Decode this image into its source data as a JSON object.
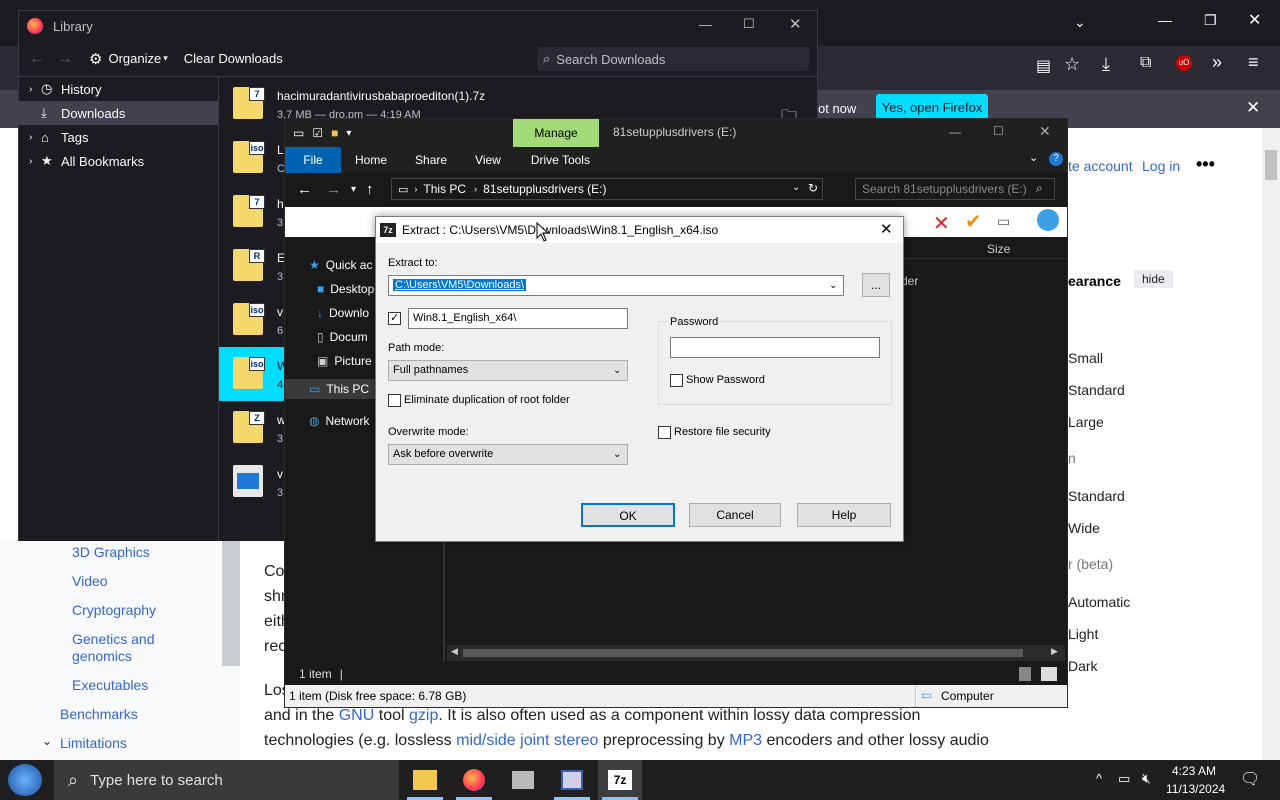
{
  "firefox": {
    "notification": {
      "not_now": "ot now",
      "open_button": "Yes, open Firefox"
    },
    "wiki": {
      "header_links": {
        "create_account": "te account",
        "login": "Log in"
      },
      "appearance": {
        "title": "earance",
        "hide": "hide"
      },
      "options": [
        "Small",
        "Standard",
        "Large",
        "n",
        "Standard",
        "Wide",
        "r (beta)",
        "Automatic",
        "Light",
        "Dark"
      ],
      "sidebar": [
        "3D Graphics",
        "Video",
        "Cryptography",
        "Genetics and",
        "genomics",
        "Executables",
        "Benchmarks",
        "Limitations"
      ],
      "body_lines": [
        "Co",
        "shr",
        "eith",
        "rec",
        "Los"
      ],
      "line1_a": "and in the ",
      "line1_gnu": "GNU",
      "line1_b": " tool ",
      "line1_gzip": "gzip",
      "line1_c": ". It is also often used as a component within lossy data compression",
      "line2_a": "technologies (e.g. lossless ",
      "line2_ms": "mid/side joint stereo",
      "line2_b": " preprocessing by ",
      "line2_mp3": "MP3",
      "line2_c": " encoders and other lossy audio"
    }
  },
  "library": {
    "title": "Library",
    "organize": "Organize",
    "clear": "Clear Downloads",
    "search_placeholder": "Search Downloads",
    "sidebar": [
      "History",
      "Downloads",
      "Tags",
      "All Bookmarks"
    ],
    "downloads": [
      {
        "name": "hacimuradantivirusbabaproediton(1).7z",
        "meta": "3.7 MB — dro.pm — 4:19 AM",
        "badge": "7"
      },
      {
        "name": "L",
        "meta": "C",
        "badge": "iso"
      },
      {
        "name": "h",
        "meta": "3",
        "badge": "7"
      },
      {
        "name": "E",
        "meta": "3",
        "badge": "R"
      },
      {
        "name": "v",
        "meta": "6",
        "badge": "iso"
      },
      {
        "name": "W",
        "meta": "4",
        "badge": "iso"
      },
      {
        "name": "w",
        "meta": "3",
        "badge": "Z"
      },
      {
        "name": "v",
        "meta": "3",
        "badge": ""
      }
    ]
  },
  "explorer": {
    "manage": "Manage",
    "drive_title": "81setupplusdrivers (E:)",
    "tabs": [
      "File",
      "Home",
      "Share",
      "View",
      "Drive Tools"
    ],
    "path": [
      "This PC",
      "81setupplusdrivers (E:)"
    ],
    "search_placeholder": "Search 81setupplusdrivers (E:)",
    "nav": [
      "Quick ac",
      "Desktop",
      "Downlo",
      "Docum",
      "Picture",
      "This PC",
      "Network"
    ],
    "size_col": "Size",
    "folder_col": "der",
    "status_items": "1 item",
    "status_bar": "1 item (Disk free space: 6.78 GB)",
    "computer": "Computer"
  },
  "extract": {
    "title": "Extract : C:\\Users\\VM5\\Downloads\\Win8.1_English_x64.iso",
    "extract_to_label": "Extract to:",
    "extract_to_value": "C:\\Users\\VM5\\Downloads\\",
    "browse": "...",
    "subfolder": "Win8.1_English_x64\\",
    "path_mode_label": "Path mode:",
    "path_mode_value": "Full pathnames",
    "eliminate": "Eliminate duplication of root folder",
    "overwrite_label": "Overwrite mode:",
    "overwrite_value": "Ask before overwrite",
    "password_label": "Password",
    "show_password": "Show Password",
    "restore_security": "Restore file security",
    "ok": "OK",
    "cancel": "Cancel",
    "help": "Help"
  },
  "taskbar": {
    "search_placeholder": "Type here to search",
    "time": "4:23 AM",
    "date": "11/13/2024"
  },
  "colors": {
    "accent_cyan": "#00ddff",
    "selection_blue": "#0078d7"
  }
}
